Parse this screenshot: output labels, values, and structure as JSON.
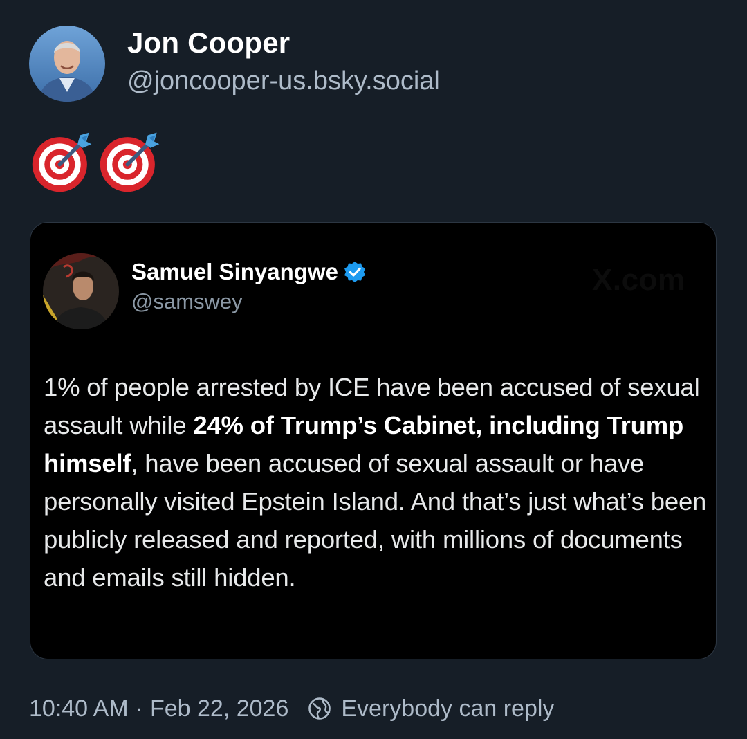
{
  "post": {
    "author": {
      "name": "Jon Cooper",
      "handle": "@joncooper-us.bsky.social",
      "avatar_icon": "avatar-photo"
    },
    "text_icons": [
      "direct-hit-icon",
      "direct-hit-icon"
    ],
    "quote": {
      "author": {
        "name": "Samuel Sinyangwe",
        "handle": "@samswey",
        "verified": true,
        "verified_color": "#1d9bf0"
      },
      "watermark": "X.com",
      "body": {
        "part1": "1% of people arrested by ICE have been accused of sexual assault while ",
        "bold": "24% of Trump’s Cabinet, including Trump himself",
        "part2": ", have been accused of sexual assault or have personally visited Epstein Island. And that’s just what’s been publicly released and reported, with millions of documents and emails still hidden."
      }
    },
    "footer": {
      "time": "10:40 AM",
      "separator": "·",
      "date": "Feb 22, 2026",
      "reply_setting": "Everybody can reply"
    }
  },
  "colors": {
    "background": "#161e27",
    "card": "#000000",
    "secondary_text": "#aebbc9"
  }
}
